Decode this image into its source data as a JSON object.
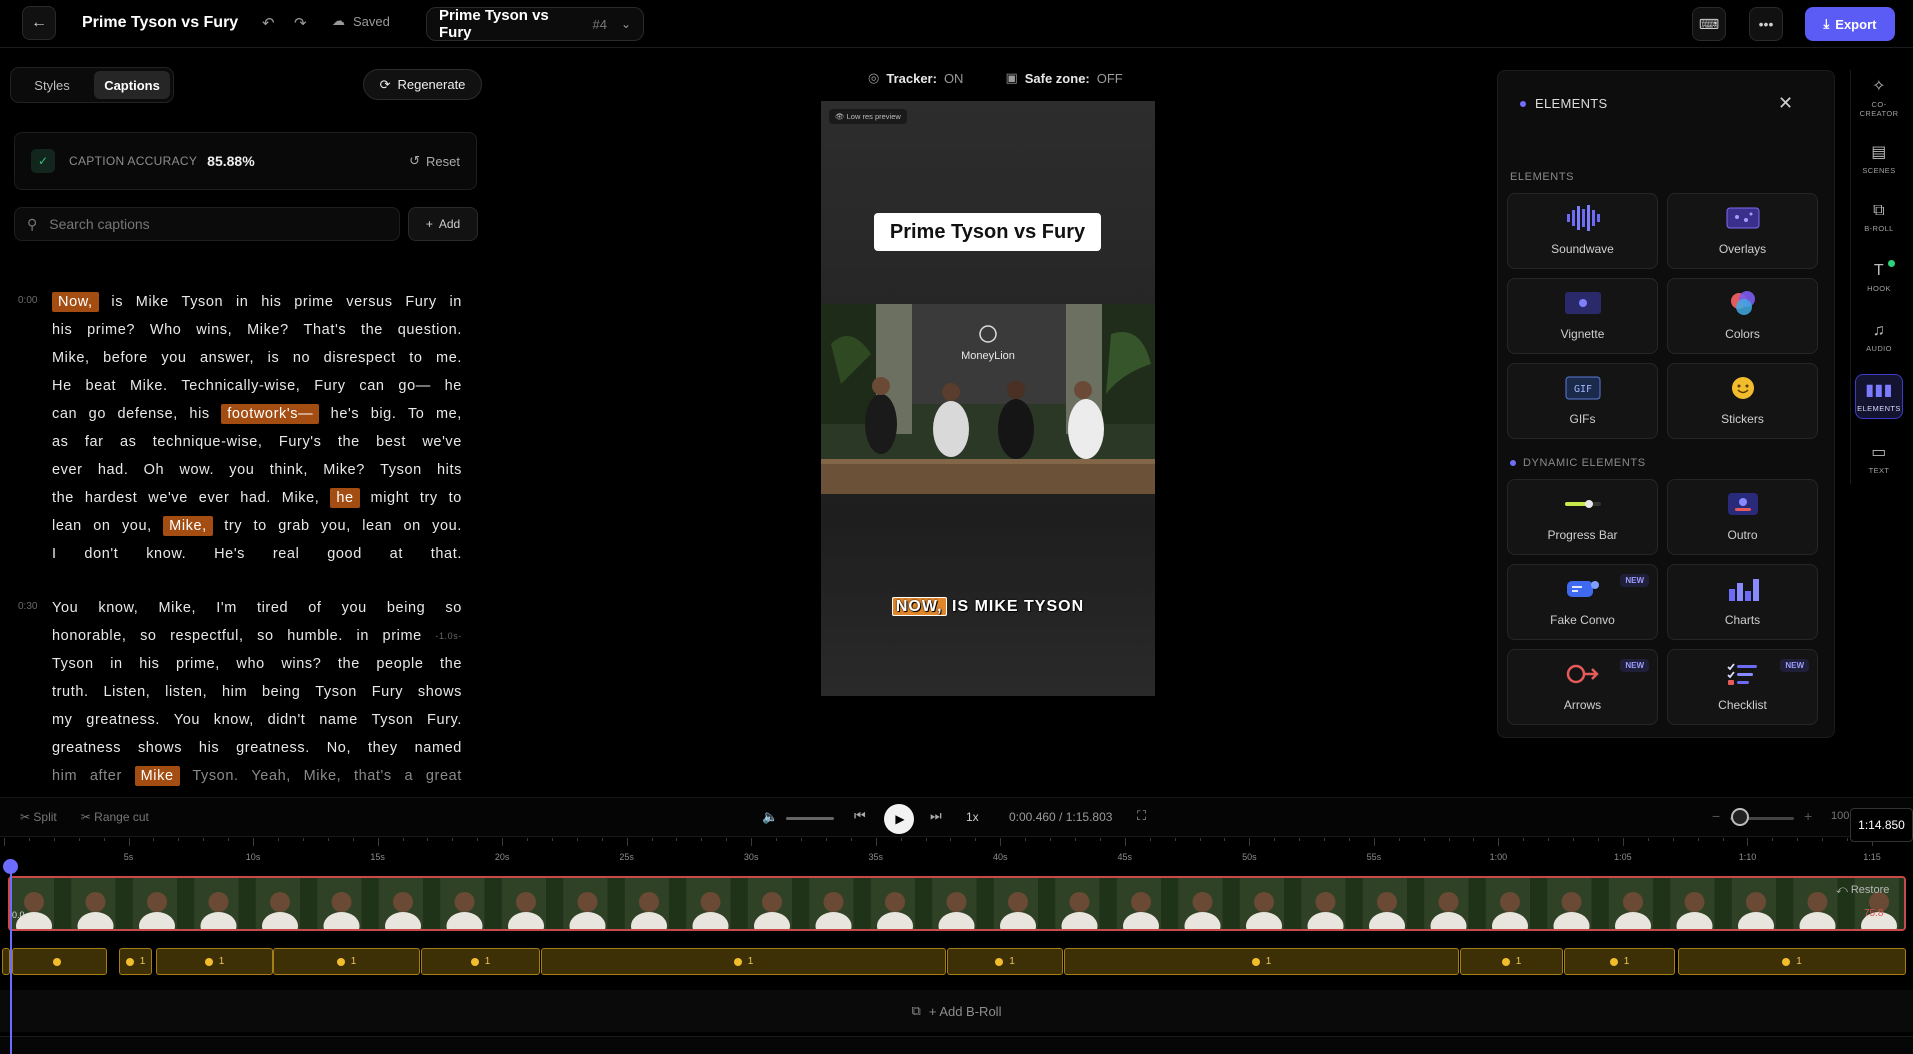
{
  "header": {
    "title": "Prime Tyson vs Fury",
    "saved_label": "Saved",
    "project_select": {
      "name": "Prime Tyson vs Fury",
      "number": "#4"
    },
    "export_label": "Export"
  },
  "left": {
    "tabs": [
      "Styles",
      "Captions"
    ],
    "regenerate_label": "Regenerate",
    "accuracy": {
      "label": "CAPTION ACCURACY",
      "value": "85.88%",
      "reset_label": "Reset"
    },
    "search_placeholder": "Search captions",
    "add_label": "Add",
    "paragraphs": [
      {
        "timestamp": "0:00",
        "lines": [
          [
            {
              "t": "Now,",
              "hl": true
            },
            {
              "t": "is"
            },
            {
              "t": "Mike"
            },
            {
              "t": "Tyson"
            },
            {
              "t": "in"
            },
            {
              "t": "his"
            },
            {
              "t": "prime"
            },
            {
              "t": "versus"
            },
            {
              "t": "Fury"
            },
            {
              "t": "in"
            }
          ],
          [
            {
              "t": "his"
            },
            {
              "t": "prime?"
            },
            {
              "t": "Who"
            },
            {
              "t": "wins,"
            },
            {
              "t": "Mike?"
            },
            {
              "t": "That's"
            },
            {
              "t": "the"
            },
            {
              "t": "question."
            }
          ],
          [
            {
              "t": "Mike,"
            },
            {
              "t": "before"
            },
            {
              "t": "you"
            },
            {
              "t": "answer,"
            },
            {
              "t": "is"
            },
            {
              "t": "no"
            },
            {
              "t": "disrespect"
            },
            {
              "t": "to"
            },
            {
              "t": "me."
            }
          ],
          [
            {
              "t": "He"
            },
            {
              "t": "beat"
            },
            {
              "t": "Mike."
            },
            {
              "t": "Technically-wise,"
            },
            {
              "t": "Fury"
            },
            {
              "t": "can"
            },
            {
              "t": "go—"
            },
            {
              "t": "he"
            }
          ],
          [
            {
              "t": "can"
            },
            {
              "t": "go"
            },
            {
              "t": "defense,"
            },
            {
              "t": "his"
            },
            {
              "t": "footwork's—",
              "hl": true
            },
            {
              "t": "he's"
            },
            {
              "t": "big."
            },
            {
              "t": "To"
            },
            {
              "t": "me,"
            }
          ],
          [
            {
              "t": "as"
            },
            {
              "t": "far"
            },
            {
              "t": "as"
            },
            {
              "t": "technique-wise,"
            },
            {
              "t": "Fury's"
            },
            {
              "t": "the"
            },
            {
              "t": "best"
            },
            {
              "t": "we've"
            }
          ],
          [
            {
              "t": "ever"
            },
            {
              "t": "had."
            },
            {
              "t": "Oh"
            },
            {
              "t": "wow."
            },
            {
              "t": "you"
            },
            {
              "t": "think,"
            },
            {
              "t": "Mike?"
            },
            {
              "t": "Tyson"
            },
            {
              "t": "hits"
            }
          ],
          [
            {
              "t": "the"
            },
            {
              "t": "hardest"
            },
            {
              "t": "we've"
            },
            {
              "t": "ever"
            },
            {
              "t": "had."
            },
            {
              "t": "Mike,"
            },
            {
              "t": "he",
              "hl": true
            },
            {
              "t": "might"
            },
            {
              "t": "try"
            },
            {
              "t": "to"
            }
          ],
          [
            {
              "t": "lean"
            },
            {
              "t": "on"
            },
            {
              "t": "you,"
            },
            {
              "t": "Mike,",
              "hl": true
            },
            {
              "t": "try"
            },
            {
              "t": "to"
            },
            {
              "t": "grab"
            },
            {
              "t": "you,"
            },
            {
              "t": "lean"
            },
            {
              "t": "on"
            },
            {
              "t": "you."
            }
          ],
          [
            {
              "t": "I"
            },
            {
              "t": "don't"
            },
            {
              "t": "know."
            },
            {
              "t": "He's"
            },
            {
              "t": "real"
            },
            {
              "t": "good"
            },
            {
              "t": "at"
            },
            {
              "t": "that."
            }
          ]
        ]
      },
      {
        "timestamp": "0:30",
        "lines": [
          [
            {
              "t": "You"
            },
            {
              "t": "know,"
            },
            {
              "t": "Mike,"
            },
            {
              "t": "I'm"
            },
            {
              "t": "tired"
            },
            {
              "t": "of"
            },
            {
              "t": "you"
            },
            {
              "t": "being"
            },
            {
              "t": "so"
            }
          ],
          [
            {
              "t": "honorable,"
            },
            {
              "t": "so"
            },
            {
              "t": "respectful,"
            },
            {
              "t": "so"
            },
            {
              "t": "humble."
            },
            {
              "t": "in"
            },
            {
              "t": "prime"
            },
            {
              "t": "-1.0s-",
              "tag": true
            }
          ],
          [
            {
              "t": "Tyson"
            },
            {
              "t": "in"
            },
            {
              "t": "his"
            },
            {
              "t": "prime,"
            },
            {
              "t": "who"
            },
            {
              "t": "wins?"
            },
            {
              "t": "the"
            },
            {
              "t": "people"
            },
            {
              "t": "the"
            }
          ],
          [
            {
              "t": "truth."
            },
            {
              "t": "Listen,"
            },
            {
              "t": "listen,"
            },
            {
              "t": "him"
            },
            {
              "t": "being"
            },
            {
              "t": "Tyson"
            },
            {
              "t": "Fury"
            },
            {
              "t": "shows"
            }
          ],
          [
            {
              "t": "my"
            },
            {
              "t": "greatness."
            },
            {
              "t": "You"
            },
            {
              "t": "know,"
            },
            {
              "t": "didn't"
            },
            {
              "t": "name"
            },
            {
              "t": "Tyson"
            },
            {
              "t": "Fury."
            }
          ],
          [
            {
              "t": "greatness"
            },
            {
              "t": "shows"
            },
            {
              "t": "his"
            },
            {
              "t": "greatness."
            },
            {
              "t": "No,"
            },
            {
              "t": "they"
            },
            {
              "t": "named"
            }
          ],
          [
            {
              "t": "him",
              "dim": true
            },
            {
              "t": "after",
              "dim": true
            },
            {
              "t": "Mike",
              "hl": true
            },
            {
              "t": "Tyson.",
              "dim": true
            },
            {
              "t": "Yeah,",
              "dim": true
            },
            {
              "t": "Mike,",
              "dim": true
            },
            {
              "t": "that's",
              "dim": true
            },
            {
              "t": "a",
              "dim": true
            },
            {
              "t": "great",
              "dim": true
            }
          ]
        ]
      }
    ]
  },
  "preview": {
    "tracker_label": "Tracker:",
    "tracker_value": "ON",
    "safezone_label": "Safe zone:",
    "safezone_value": "OFF",
    "lowres_label": "Low res preview",
    "title_card": "Prime Tyson vs Fury",
    "sign_text": "MoneyLion",
    "caption_highlight": "NOW,",
    "caption_rest": "IS MIKE TYSON"
  },
  "elements_panel": {
    "title": "ELEMENTS",
    "section_elements": "ELEMENTS",
    "section_dynamic": "DYNAMIC ELEMENTS",
    "items": [
      {
        "label": "Soundwave",
        "icon": "soundwave-icon"
      },
      {
        "label": "Overlays",
        "icon": "overlays-icon"
      },
      {
        "label": "Vignette",
        "icon": "vignette-icon"
      },
      {
        "label": "Colors",
        "icon": "colors-icon"
      },
      {
        "label": "GIFs",
        "icon": "gif-icon"
      },
      {
        "label": "Stickers",
        "icon": "sticker-icon"
      }
    ],
    "dynamic_items": [
      {
        "label": "Progress Bar",
        "icon": "progress-bar-icon",
        "badge": ""
      },
      {
        "label": "Outro",
        "icon": "outro-icon",
        "badge": ""
      },
      {
        "label": "Fake Convo",
        "icon": "fake-convo-icon",
        "badge": "NEW"
      },
      {
        "label": "Charts",
        "icon": "charts-icon",
        "badge": ""
      },
      {
        "label": "Arrows",
        "icon": "arrow-icon",
        "badge": "NEW"
      },
      {
        "label": "Checklist",
        "icon": "checklist-icon",
        "badge": "NEW"
      }
    ]
  },
  "rail": [
    "CO-CREATOR",
    "SCENES",
    "B-ROLL",
    "HOOK",
    "AUDIO",
    "ELEMENTS",
    "TEXT"
  ],
  "playback": {
    "split_label": "Split",
    "range_cut_label": "Range cut",
    "speed": "1x",
    "time": "0:00.460 / 1:15.803",
    "zoom": "100",
    "hover_time": "1:14.850"
  },
  "timeline": {
    "ticks": [
      "5s",
      "10s",
      "15s",
      "20s",
      "25s",
      "30s",
      "35s",
      "40s",
      "45s",
      "50s",
      "55s",
      "1:00",
      "1:05",
      "1:10",
      "1:15"
    ],
    "restore_label": "Restore",
    "video_start_label": "0.0",
    "video_pct_label": "75.8",
    "caption_segments": [
      "1",
      "",
      "1",
      "1",
      "1",
      "1",
      "1",
      "1",
      "1",
      "1",
      "1",
      "1"
    ],
    "add_broll_label": "+ Add B-Roll"
  },
  "colors": {
    "accent": "#5b5bf5",
    "highlight": "#a34d12",
    "caption_track": "#3d2f06"
  }
}
